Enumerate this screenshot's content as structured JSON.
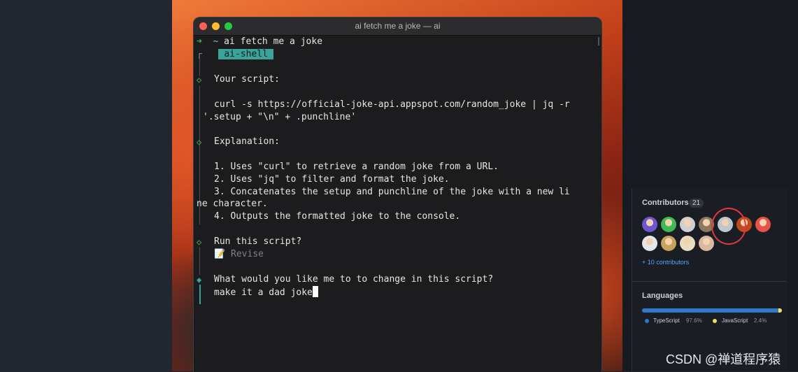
{
  "terminal": {
    "window_title": "ai fetch me a joke — ai",
    "prompt_arrow": "➜",
    "prompt_tilde": "~",
    "command": "ai fetch me a joke",
    "shell_badge": "ai-shell",
    "your_script_label": "Your script:",
    "script_line_1": "curl -s https://official-joke-api.appspot.com/random_joke | jq -r",
    "script_line_2": "'.setup + \"\\n\" + .punchline'",
    "explanation_label": "Explanation:",
    "explanation_lines": [
      "1. Uses \"curl\" to retrieve a random joke from a URL.",
      "2. Uses \"jq\" to filter and format the joke.",
      "3. Concatenates the setup and punchline of the joke with a new li",
      "ne character.",
      "4. Outputs the formatted joke to the console."
    ],
    "run_question": "Run this script?",
    "revise_icon": "memo-icon",
    "revise_glyph": "📝",
    "revise_label": "Revise",
    "change_question": "What would you like me to to change in this script?",
    "user_input": "make it a dad joke"
  },
  "sidebar": {
    "contributors": {
      "title": "Contributors",
      "count": "21",
      "more_link": "+ 10 contributors",
      "avatar_colors": [
        "#6e56cf",
        "#3fb950",
        "#d0d0d0",
        "#8a7a60",
        "#c0c6cf",
        "#c04a1a",
        "#e5534b",
        "#e7e7e7",
        "#c8a15a",
        "#e9dcc0",
        "#d9b9a0"
      ]
    },
    "languages": {
      "title": "Languages",
      "items": [
        {
          "name": "TypeScript",
          "percent": "97.6%",
          "share": 97.6,
          "color": "#3178c6"
        },
        {
          "name": "JavaScript",
          "percent": "2.4%",
          "share": 2.4,
          "color": "#f1e05a"
        }
      ]
    }
  },
  "watermark": "CSDN @禅道程序猿"
}
